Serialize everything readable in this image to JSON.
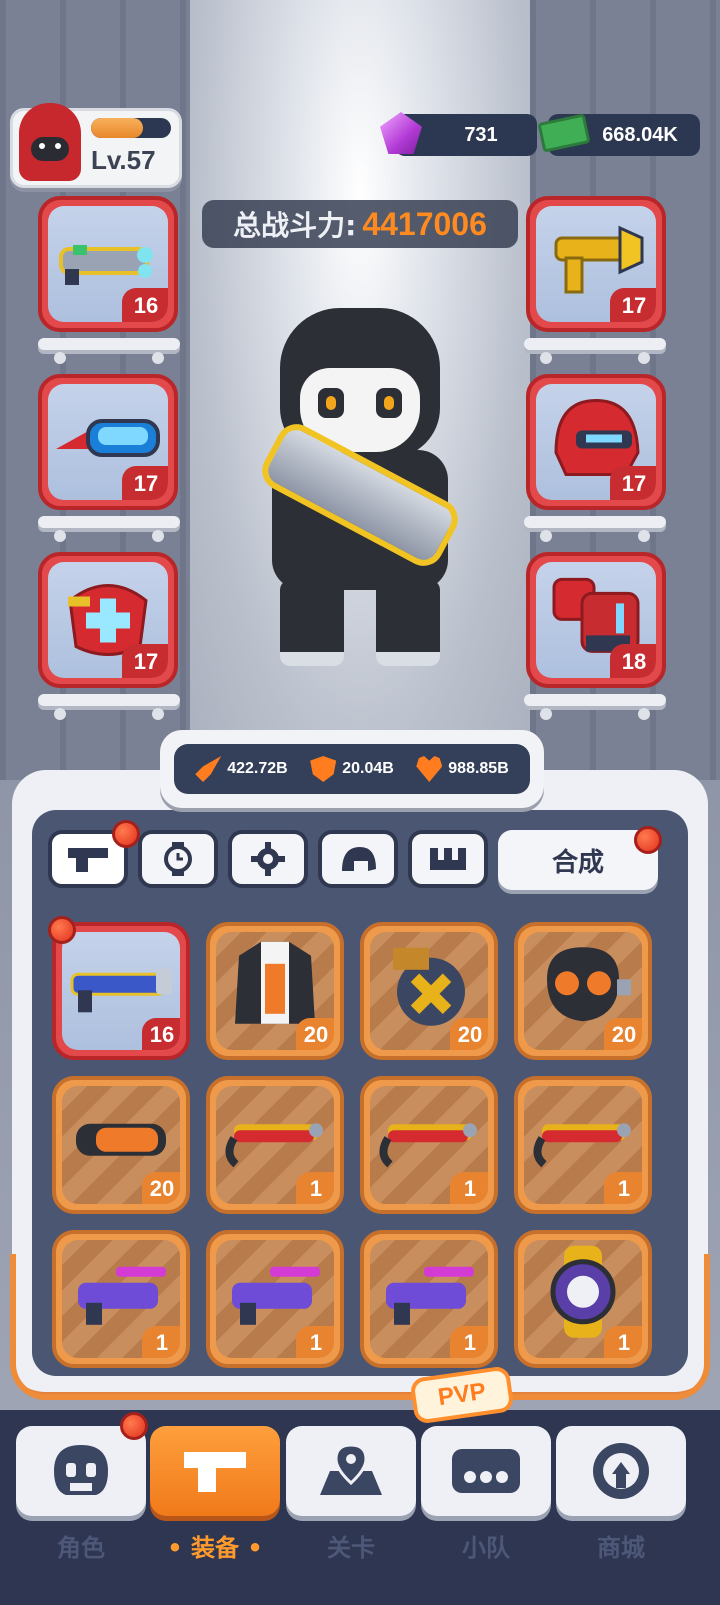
{
  "player": {
    "level": "Lv.57",
    "xp_progress": 0.65
  },
  "currency": {
    "gems": "731",
    "cash": "668.04K"
  },
  "power": {
    "label": "总战斗力:",
    "value": "4417006"
  },
  "equipped": {
    "left": [
      {
        "name": "plasma-rifle",
        "level": "16"
      },
      {
        "name": "goggles",
        "level": "17"
      },
      {
        "name": "chest-armor",
        "level": "17"
      }
    ],
    "right": [
      {
        "name": "golden-pistol",
        "level": "17"
      },
      {
        "name": "red-helmet",
        "level": "17"
      },
      {
        "name": "red-gauntlet",
        "level": "18"
      }
    ]
  },
  "stats": {
    "attack": "422.72B",
    "defense": "20.04B",
    "health": "988.85B"
  },
  "tabs": {
    "items": [
      {
        "name": "weapon",
        "icon": "gun-icon"
      },
      {
        "name": "watch",
        "icon": "watch-icon"
      },
      {
        "name": "gear",
        "icon": "gear-icon"
      },
      {
        "name": "helmet",
        "icon": "helmet-icon"
      },
      {
        "name": "boots",
        "icon": "boots-icon"
      }
    ],
    "merge_label": "合成"
  },
  "inventory": [
    {
      "name": "blue-rifle",
      "level": "16",
      "rarity": "red"
    },
    {
      "name": "jacket",
      "level": "20",
      "rarity": "orange"
    },
    {
      "name": "ammo-drum",
      "level": "20",
      "rarity": "orange"
    },
    {
      "name": "gas-mask",
      "level": "20",
      "rarity": "orange"
    },
    {
      "name": "orange-goggles",
      "level": "20",
      "rarity": "orange"
    },
    {
      "name": "red-shotgun",
      "level": "1",
      "rarity": "orange"
    },
    {
      "name": "red-shotgun",
      "level": "1",
      "rarity": "orange"
    },
    {
      "name": "red-shotgun",
      "level": "1",
      "rarity": "orange"
    },
    {
      "name": "purple-smg",
      "level": "1",
      "rarity": "orange"
    },
    {
      "name": "purple-smg",
      "level": "1",
      "rarity": "orange"
    },
    {
      "name": "purple-smg",
      "level": "1",
      "rarity": "orange"
    },
    {
      "name": "gold-watch",
      "level": "1",
      "rarity": "orange"
    }
  ],
  "nav": {
    "items": [
      {
        "label": "角色",
        "icon": "skull-icon"
      },
      {
        "label": "装备",
        "icon": "gun-icon"
      },
      {
        "label": "关卡",
        "icon": "map-pin-icon"
      },
      {
        "label": "小队",
        "icon": "team-icon"
      },
      {
        "label": "商城",
        "icon": "shop-icon"
      }
    ],
    "pvp_label": "PVP",
    "active": "装备"
  },
  "colors": {
    "accent": "#ff8a1f",
    "panel_dark": "#344059",
    "slot_red": "#e3484a",
    "slot_orange": "#ef9a4a"
  }
}
